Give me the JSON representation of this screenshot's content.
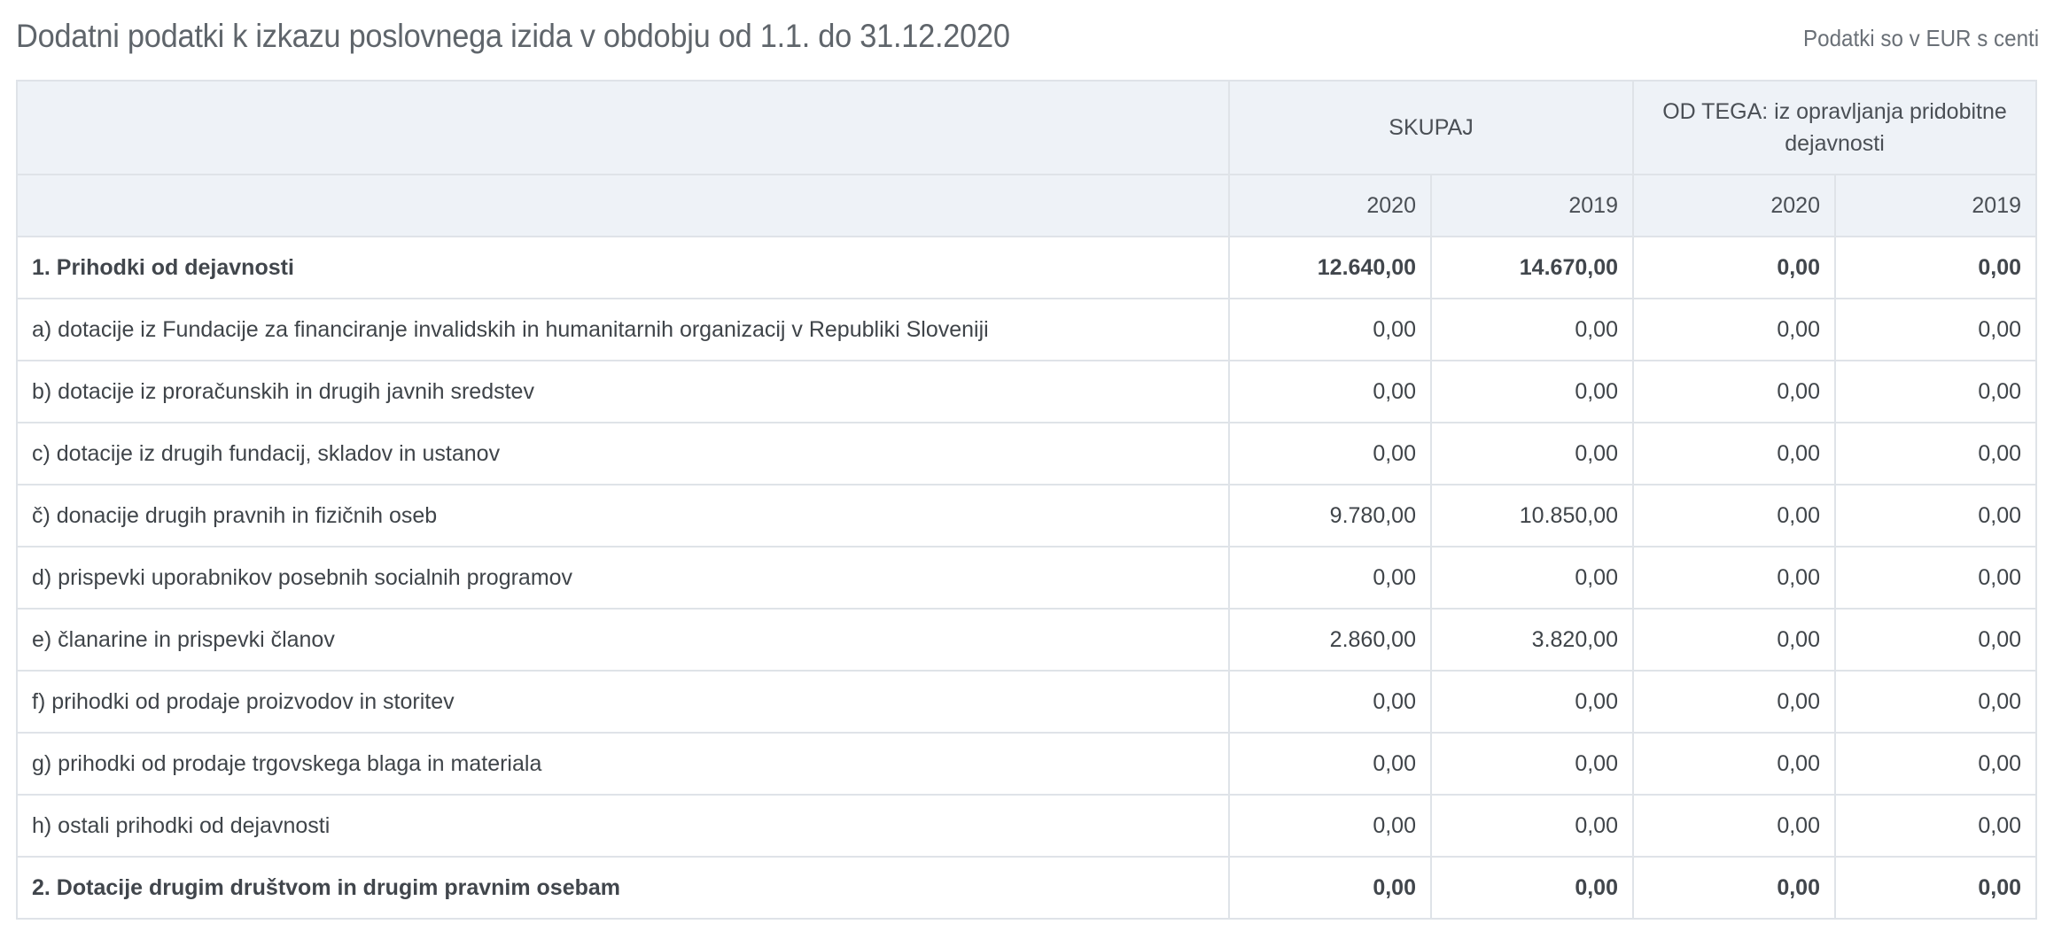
{
  "header": {
    "title": "Dodatni podatki k izkazu poslovnega izida v obdobju od 1.1. do 31.12.2020",
    "unit_note": "Podatki so v EUR s centi"
  },
  "table": {
    "group_headers": {
      "label": "",
      "total": "SKUPAJ",
      "gainful": "OD TEGA: iz opravljanja pridobitne dejavnosti"
    },
    "years": [
      "2020",
      "2019",
      "2020",
      "2019"
    ],
    "rows": [
      {
        "label": "1. Prihodki od dejavnosti",
        "bold": true,
        "values": [
          "12.640,00",
          "14.670,00",
          "0,00",
          "0,00"
        ]
      },
      {
        "label": "a) dotacije iz Fundacije za financiranje invalidskih in humanitarnih organizacij v Republiki Sloveniji",
        "bold": false,
        "values": [
          "0,00",
          "0,00",
          "0,00",
          "0,00"
        ]
      },
      {
        "label": "b) dotacije iz proračunskih in drugih javnih sredstev",
        "bold": false,
        "values": [
          "0,00",
          "0,00",
          "0,00",
          "0,00"
        ]
      },
      {
        "label": "c) dotacije iz drugih fundacij, skladov in ustanov",
        "bold": false,
        "values": [
          "0,00",
          "0,00",
          "0,00",
          "0,00"
        ]
      },
      {
        "label": "č) donacije drugih pravnih in fizičnih oseb",
        "bold": false,
        "values": [
          "9.780,00",
          "10.850,00",
          "0,00",
          "0,00"
        ]
      },
      {
        "label": "d) prispevki uporabnikov posebnih socialnih programov",
        "bold": false,
        "values": [
          "0,00",
          "0,00",
          "0,00",
          "0,00"
        ]
      },
      {
        "label": "e) članarine in prispevki članov",
        "bold": false,
        "values": [
          "2.860,00",
          "3.820,00",
          "0,00",
          "0,00"
        ]
      },
      {
        "label": "f) prihodki od prodaje proizvodov in storitev",
        "bold": false,
        "values": [
          "0,00",
          "0,00",
          "0,00",
          "0,00"
        ]
      },
      {
        "label": "g) prihodki od prodaje trgovskega blaga in materiala",
        "bold": false,
        "values": [
          "0,00",
          "0,00",
          "0,00",
          "0,00"
        ]
      },
      {
        "label": "h) ostali prihodki od dejavnosti",
        "bold": false,
        "values": [
          "0,00",
          "0,00",
          "0,00",
          "0,00"
        ]
      },
      {
        "label": "2. Dotacije drugim društvom in drugim pravnim osebam",
        "bold": true,
        "values": [
          "0,00",
          "0,00",
          "0,00",
          "0,00"
        ]
      }
    ]
  }
}
